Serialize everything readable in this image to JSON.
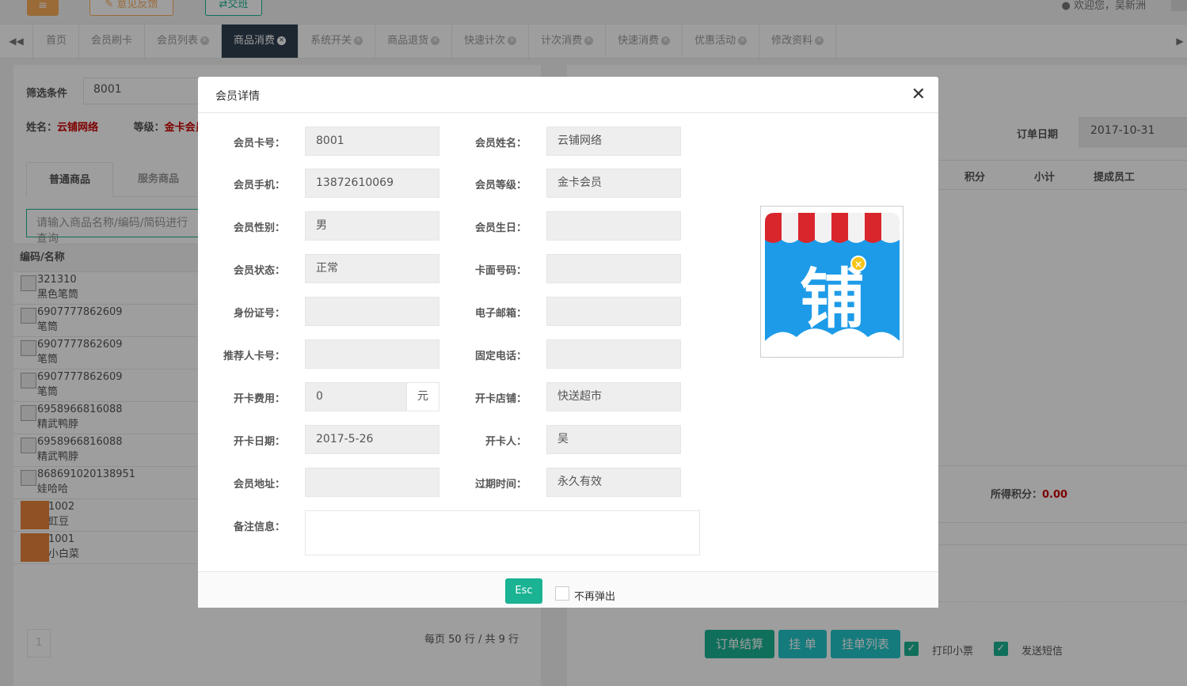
{
  "topbar": {
    "feedback_label": "意见反馈",
    "shift_label": "交班",
    "welcome_text": "欢迎您，吴新洲"
  },
  "tabs": [
    {
      "label": "首页",
      "closable": false,
      "active": false
    },
    {
      "label": "会员刷卡",
      "closable": false,
      "active": false
    },
    {
      "label": "会员列表",
      "closable": true,
      "active": false
    },
    {
      "label": "商品消费",
      "closable": true,
      "active": true
    },
    {
      "label": "系统开关",
      "closable": true,
      "active": false
    },
    {
      "label": "商品退货",
      "closable": true,
      "active": false
    },
    {
      "label": "快速计次",
      "closable": true,
      "active": false
    },
    {
      "label": "计次消费",
      "closable": true,
      "active": false
    },
    {
      "label": "快速消费",
      "closable": true,
      "active": false
    },
    {
      "label": "优惠活动",
      "closable": true,
      "active": false
    },
    {
      "label": "修改资料",
      "closable": true,
      "active": false
    }
  ],
  "left": {
    "filter_label": "筛选条件",
    "filter_value": "8001",
    "name_label": "姓名：",
    "name_value": "云铺网络",
    "level_label": "等级：",
    "level_value": "金卡会员",
    "tab_normal": "普通商品",
    "tab_service": "服务商品",
    "search_placeholder": "请输入商品名称/编码/简码进行查询",
    "col_header": "编码/名称",
    "products": [
      {
        "code": "321310",
        "name": "黑色笔筒",
        "orange": false
      },
      {
        "code": "6907777862609",
        "name": "笔筒",
        "orange": false
      },
      {
        "code": "6907777862609",
        "name": "笔筒",
        "orange": false
      },
      {
        "code": "6907777862609",
        "name": "笔筒",
        "orange": false
      },
      {
        "code": "6958966816088",
        "name": "精武鸭脖",
        "orange": false
      },
      {
        "code": "6958966816088",
        "name": "精武鸭脖",
        "orange": false
      },
      {
        "code": "868691020138951",
        "name": "娃哈哈",
        "orange": false
      },
      {
        "code": "1002",
        "name": "豇豆",
        "orange": true
      },
      {
        "code": "1001",
        "name": "小白菜",
        "orange": true
      }
    ],
    "page_num": "1",
    "pager_text": "每页 50 行 / 共 9 行"
  },
  "right": {
    "date_label": "订单日期",
    "date_value": "2017-10-31",
    "col_points": "积分",
    "col_subtotal": "小计",
    "col_staff": "提成员工",
    "points_label": "所得积分：",
    "points_value": "0.00",
    "btn_checkout": "订单结算",
    "btn_hold": "挂 单",
    "btn_hold_list": "挂单列表",
    "print_label": "打印小票",
    "sms_label": "发送短信"
  },
  "modal": {
    "title": "会员详情",
    "fields": {
      "card_no_label": "会员卡号：",
      "card_no": "8001",
      "name_label": "会员姓名：",
      "name": "云铺网络",
      "phone_label": "会员手机：",
      "phone": "13872610069",
      "level_label": "会员等级：",
      "level": "金卡会员",
      "gender_label": "会员性别：",
      "gender": "男",
      "birthday_label": "会员生日：",
      "birthday": "",
      "status_label": "会员状态：",
      "status": "正常",
      "face_no_label": "卡面号码：",
      "face_no": "",
      "id_label": "身份证号：",
      "id": "",
      "email_label": "电子邮箱：",
      "email": "",
      "referrer_label": "推荐人卡号：",
      "referrer": "",
      "tel_label": "固定电话：",
      "tel": "",
      "fee_label": "开卡费用：",
      "fee": "0",
      "fee_unit": "元",
      "shop_label": "开卡店铺：",
      "shop": "快送超市",
      "open_date_label": "开卡日期：",
      "open_date": "2017-5-26",
      "opener_label": "开卡人：",
      "opener": "吴",
      "address_label": "会员地址：",
      "address": "",
      "expire_label": "过期时间：",
      "expire": "永久有效",
      "remark_label": "备注信息：",
      "remark": ""
    },
    "logo_char": "铺",
    "esc_label": "Esc",
    "no_popup_label": "不再弹出"
  },
  "colors": {
    "primary": "#1ab394",
    "warning": "#f8ac59",
    "dark": "#2f4050",
    "danger": "#cc0000"
  }
}
